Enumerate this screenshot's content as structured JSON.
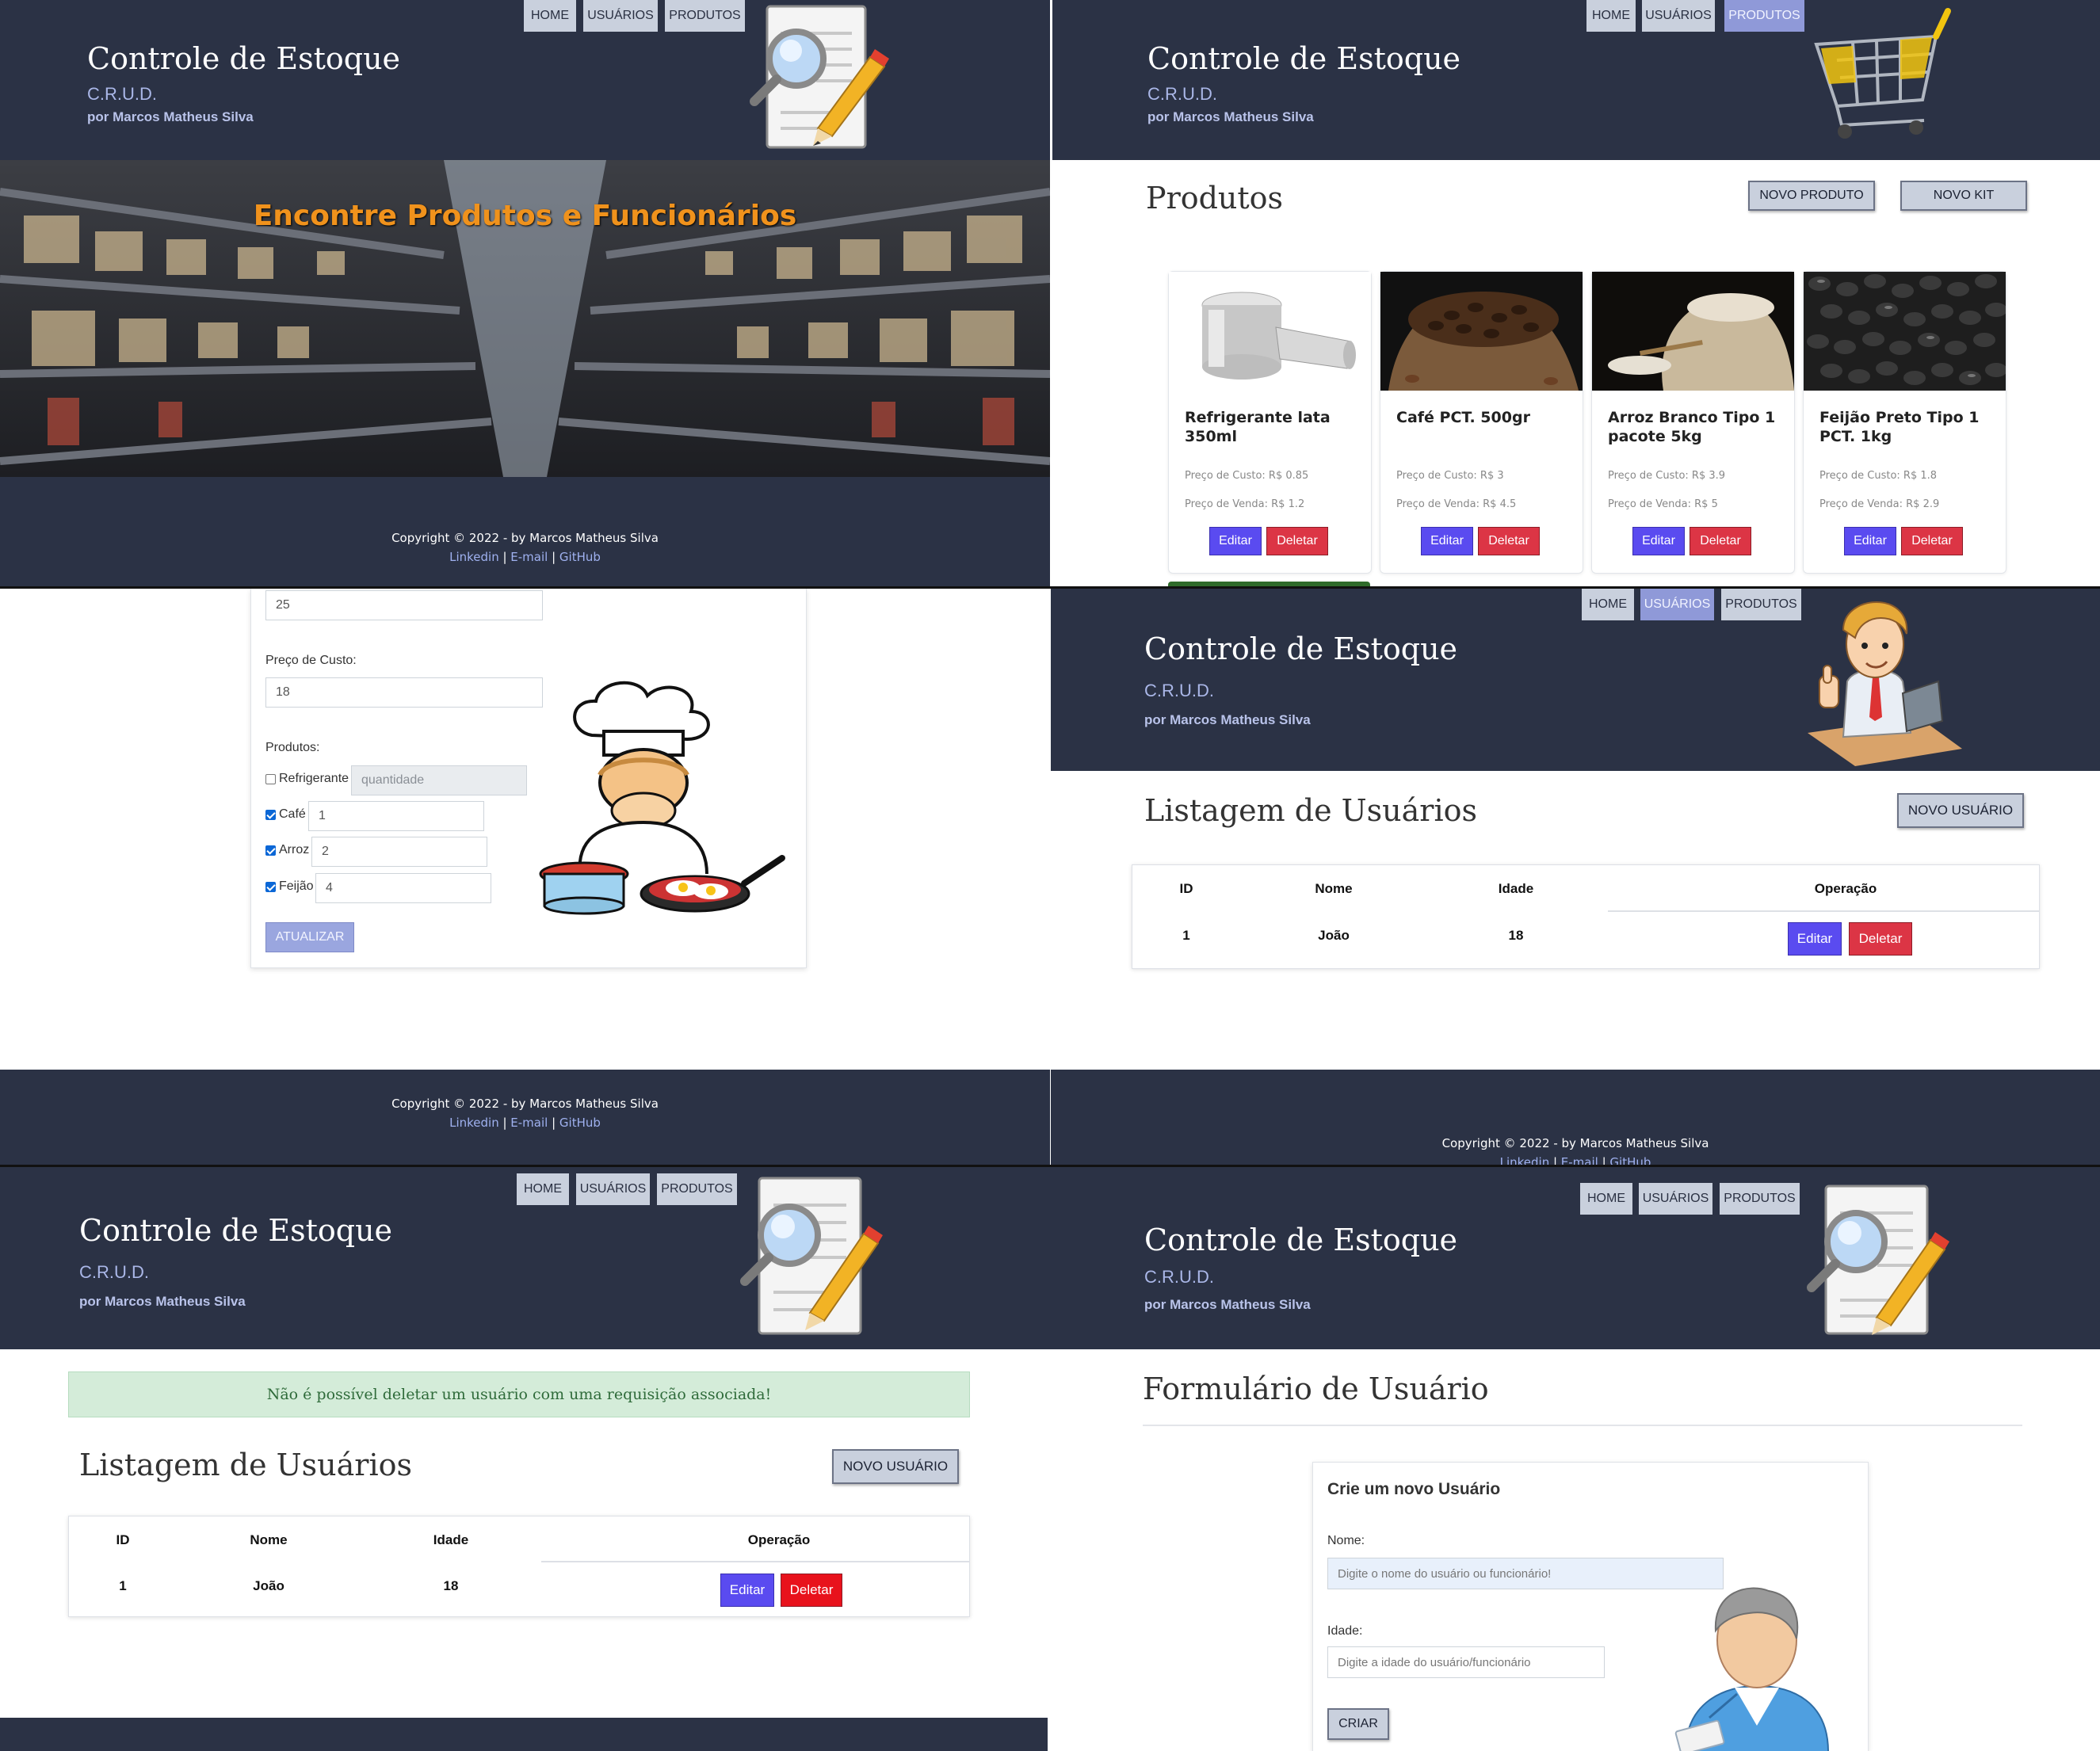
{
  "app": {
    "title": "Controle de Estoque",
    "subtitle": "C.R.U.D.",
    "author": "por Marcos Matheus Silva"
  },
  "nav": {
    "home": "HOME",
    "users": "USUÁRIOS",
    "products": "PRODUTOS"
  },
  "footer": {
    "copyright": "Copyright © 2022 - by Marcos Matheus Silva",
    "linkedin": "Linkedin",
    "email": "E-mail",
    "github": "GitHub",
    "sep": " | "
  },
  "home": {
    "banner_text": "Encontre Produtos e Funcionários",
    "header_icon": "search-document-icon"
  },
  "products": {
    "header_icon": "shopping-cart-icon",
    "heading": "Produtos",
    "new_product": "NOVO PRODUTO",
    "new_kit": "NOVO KIT",
    "items": [
      {
        "name": "Refrigerante lata 350ml",
        "cost": "Preço de Custo: R$ 0.85",
        "sale": "Preço de Venda: R$ 1.2",
        "image": "soda-can-icon"
      },
      {
        "name": "Café PCT. 500gr",
        "cost": "Preço de Custo: R$ 3",
        "sale": "Preço de Venda: R$ 4.5",
        "image": "coffee-beans-icon"
      },
      {
        "name": "Arroz Branco Tipo 1 pacote 5kg",
        "cost": "Preço de Custo: R$ 3.9",
        "sale": "Preço de Venda: R$ 5",
        "image": "rice-sack-icon"
      },
      {
        "name": "Feijão Preto Tipo 1 PCT. 1kg",
        "cost": "Preço de Custo: R$ 1.8",
        "sale": "Preço de Venda: R$ 2.9",
        "image": "black-beans-icon"
      }
    ],
    "edit": "Editar",
    "delete": "Deletar"
  },
  "kit_form": {
    "quantity_value": "25",
    "cost_label": "Preço de Custo:",
    "cost_value": "18",
    "products_label": "Produtos:",
    "items": [
      {
        "name": "Refrigerante",
        "checked": false,
        "value": "",
        "placeholder": "quantidade"
      },
      {
        "name": "Café",
        "checked": true,
        "value": "1"
      },
      {
        "name": "Arroz",
        "checked": true,
        "value": "2"
      },
      {
        "name": "Feijão",
        "checked": true,
        "value": "4"
      }
    ],
    "update": "ATUALIZAR",
    "illustration": "chef-cooking-icon"
  },
  "users": {
    "header_icon": "office-worker-icon",
    "heading": "Listagem de Usuários",
    "new_user": "NOVO USUÁRIO",
    "columns": [
      "ID",
      "Nome",
      "Idade",
      "Operação"
    ],
    "rows": [
      {
        "id": "1",
        "name": "João",
        "age": "18"
      }
    ],
    "edit": "Editar",
    "delete": "Deletar"
  },
  "users_error": {
    "alert": "Não é possível deletar um usuário com uma requisição associada!"
  },
  "user_form": {
    "heading": "Formulário de Usuário",
    "card_title": "Crie um novo Usuário",
    "name_label": "Nome:",
    "name_placeholder": "Digite o nome do usuário ou funcionário!",
    "age_label": "Idade:",
    "age_placeholder": "Digite a idade do usuário/funcionário",
    "create": "CRIAR",
    "illustration": "user-avatar-icon"
  },
  "colors": {
    "header_bg": "#2b3245",
    "nav_btn": "#c9d0dd",
    "nav_active": "#8f99d8",
    "edit_btn": "#5a4bf0",
    "delete_btn": "#dc3545",
    "banner_text": "#f0921c",
    "alert_bg": "#d4ecd9"
  }
}
